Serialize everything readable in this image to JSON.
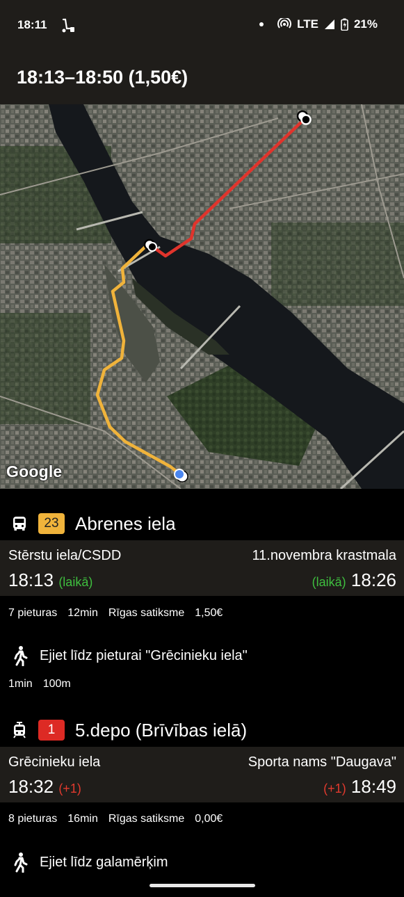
{
  "status_bar": {
    "time": "18:11",
    "network": "LTE",
    "battery": "21%"
  },
  "app_bar": {
    "title": "18:13–18:50 (1,50€)"
  },
  "map": {
    "attribution": "Google",
    "route_colors": {
      "bus": "#f0b33b",
      "tram": "#e0342c"
    },
    "start_marker_color": "#4a86f0"
  },
  "legs": [
    {
      "type": "bus",
      "icon": "bus-icon",
      "route_number": "23",
      "badge_color": "#f0b33b",
      "destination": "Abrenes iela",
      "from_stop": "Stērstu iela/CSDD",
      "to_stop": "11.novembra krastmala",
      "departure_time": "18:13",
      "departure_status": "(laikā)",
      "arrival_time": "18:26",
      "arrival_status": "(laikā)",
      "stops": "7 pieturas",
      "duration": "12min",
      "operator": "Rīgas satiksme",
      "price": "1,50€"
    },
    {
      "type": "walk",
      "icon": "walking-person-icon",
      "text": "Ejiet līdz pieturai \"Grēcinieku iela\"",
      "duration": "1min",
      "distance": "100m"
    },
    {
      "type": "tram",
      "icon": "tram-icon",
      "route_number": "1",
      "badge_color": "#dd2a24",
      "destination": "5.depo (Brīvības ielā)",
      "from_stop": "Grēcinieku iela",
      "to_stop": "Sporta nams \"Daugava\"",
      "departure_time": "18:32",
      "departure_status": "(+1)",
      "arrival_time": "18:49",
      "arrival_status": "(+1)",
      "stops": "8 pieturas",
      "duration": "16min",
      "operator": "Rīgas satiksme",
      "price": "0,00€"
    },
    {
      "type": "walk",
      "icon": "walking-person-icon",
      "text": "Ejiet līdz galamērķim"
    }
  ]
}
